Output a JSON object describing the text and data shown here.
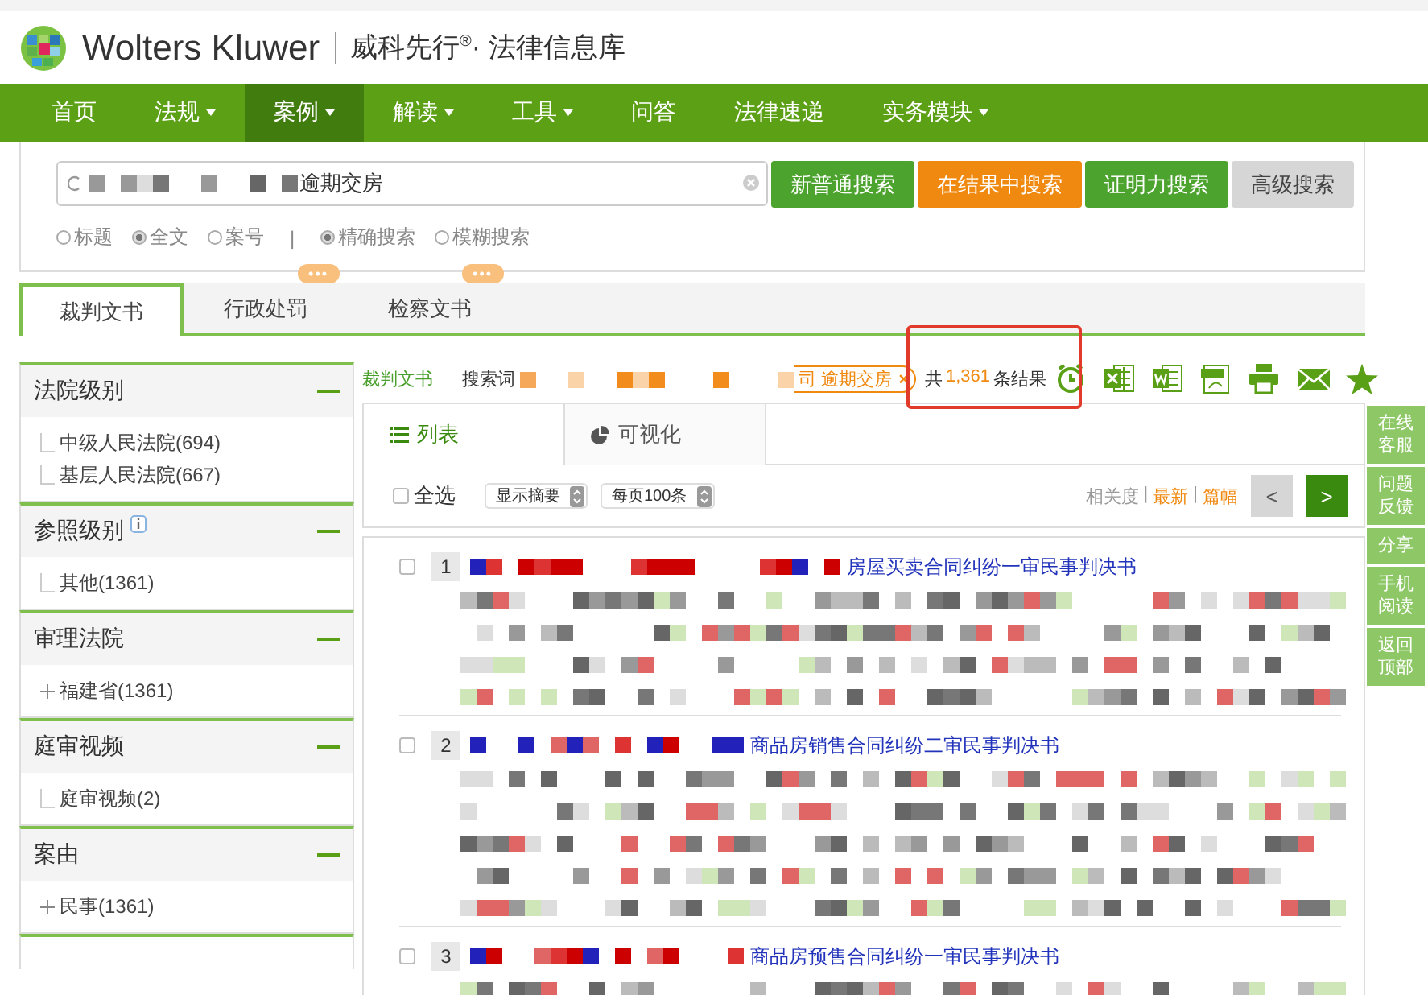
{
  "brand": {
    "name": "Wolters Kluwer",
    "product": "威科先行$^{®}$· 法律信息库"
  },
  "nav": [
    {
      "label": "首页",
      "has_menu": false,
      "selected": false
    },
    {
      "label": "法规",
      "has_menu": true,
      "selected": false
    },
    {
      "label": "案例",
      "has_menu": true,
      "selected": true
    },
    {
      "label": "解读",
      "has_menu": true,
      "selected": false
    },
    {
      "label": "工具",
      "has_menu": true,
      "selected": false
    },
    {
      "label": "问答",
      "has_menu": false,
      "selected": false
    },
    {
      "label": "法律速递",
      "has_menu": false,
      "selected": false
    },
    {
      "label": "实务模块",
      "has_menu": true,
      "selected": false
    }
  ],
  "search": {
    "value": "逾期交房",
    "buttons": [
      {
        "label": "新普通搜索",
        "kind": "primary"
      },
      {
        "label": "在结果中搜索",
        "kind": "accent"
      },
      {
        "label": "证明力搜索",
        "kind": "primary"
      },
      {
        "label": "高级搜索",
        "kind": "plain"
      }
    ],
    "scope_options": [
      {
        "label": "标题",
        "selected": false
      },
      {
        "label": "全文",
        "selected": true
      },
      {
        "label": "案号",
        "selected": false
      }
    ],
    "separator": "|",
    "match_options": [
      {
        "label": "精确搜索",
        "selected": true
      },
      {
        "label": "模糊搜索",
        "selected": false
      }
    ]
  },
  "doc_tabs": [
    {
      "label": "裁判文书",
      "selected": true
    },
    {
      "label": "行政处罚",
      "selected": false,
      "badge": "•••"
    },
    {
      "label": "检察文书",
      "selected": false,
      "badge": "•••"
    }
  ],
  "filters": [
    {
      "title": "法院级别",
      "info": false,
      "items": [
        {
          "label": "中级人民法院(694)",
          "kind": "leaf"
        },
        {
          "label": "基层人民法院(667)",
          "kind": "leaf"
        }
      ]
    },
    {
      "title": "参照级别",
      "info": true,
      "items": [
        {
          "label": "其他(1361)",
          "kind": "leaf"
        }
      ]
    },
    {
      "title": "审理法院",
      "info": false,
      "items": [
        {
          "label": "福建省(1361)",
          "kind": "expandable"
        }
      ]
    },
    {
      "title": "庭审视频",
      "info": false,
      "items": [
        {
          "label": "庭审视频(2)",
          "kind": "leaf"
        }
      ]
    },
    {
      "title": "案由",
      "info": false,
      "items": [
        {
          "label": "民事(1361)",
          "kind": "expandable"
        }
      ]
    }
  ],
  "results_header": {
    "category": "裁判文书",
    "search_term_label": "搜索词",
    "term_tag": "司 逾期交房",
    "tag_close": "×",
    "count_prefix": "共",
    "count": "1,361",
    "count_suffix": "条结果",
    "count_highlighted": true
  },
  "view_tabs": [
    {
      "label": "列表",
      "selected": true,
      "kind": "list"
    },
    {
      "label": "可视化",
      "selected": false,
      "kind": "chart"
    }
  ],
  "controls": {
    "select_all": {
      "label": "全选",
      "checked": false
    },
    "display": "显示摘要",
    "per_page": "每页100条",
    "sort": [
      {
        "label": "相关度",
        "selected": true
      },
      {
        "label": "最新",
        "selected": false
      },
      {
        "label": "篇幅",
        "selected": false
      }
    ],
    "sort_separators": [
      "|",
      "|"
    ],
    "prev": {
      "label": "<",
      "disabled": true
    },
    "next": {
      "label": ">",
      "disabled": false
    }
  },
  "results": [
    {
      "number": "1",
      "title": "房屋买卖合同纠纷一审民事判决书",
      "checked": false
    },
    {
      "number": "2",
      "title": "商品房销售合同纠纷二审民事判决书",
      "checked": false
    },
    {
      "number": "3",
      "title": "商品房预售合同纠纷一审民事判决书",
      "checked": false
    }
  ],
  "side_tools": [
    "在线客服",
    "问题反馈",
    "分享",
    "手机阅读",
    "返回顶部"
  ]
}
